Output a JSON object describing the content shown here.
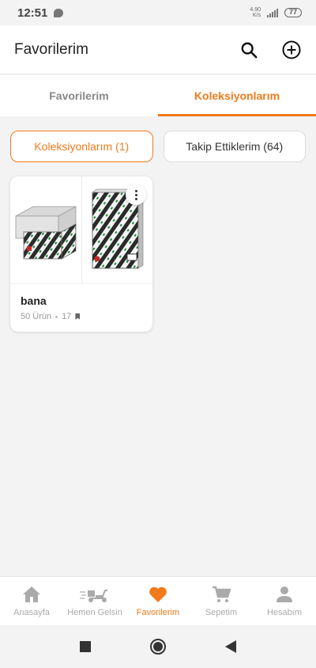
{
  "status_bar": {
    "time": "12:51",
    "net_speed_top": "4.90",
    "net_speed_bottom": "K/s",
    "battery": "77"
  },
  "header": {
    "title": "Favorilerim",
    "search_icon": "search-icon",
    "add_icon": "add-circle-icon"
  },
  "tabs": [
    {
      "label": "Favorilerim",
      "active": false
    },
    {
      "label": "Koleksiyonlarım",
      "active": true
    }
  ],
  "segments": [
    {
      "label": "Koleksiyonlarım (1)",
      "active": true
    },
    {
      "label": "Takip Ettiklerim (64)",
      "active": false
    }
  ],
  "collections": [
    {
      "name": "bana",
      "product_count": "50 Ürün",
      "follower_count": "17",
      "images": [
        "paper-box-image",
        "paper-ream-image"
      ]
    }
  ],
  "bottom_nav": [
    {
      "label": "Anasayfa",
      "icon": "home-icon",
      "active": false
    },
    {
      "label": "Hemen Gelsin",
      "icon": "scooter-icon",
      "active": false
    },
    {
      "label": "Favorilerim",
      "icon": "heart-icon",
      "active": true
    },
    {
      "label": "Sepetim",
      "icon": "cart-icon",
      "active": false
    },
    {
      "label": "Hesabım",
      "icon": "user-icon",
      "active": false
    }
  ],
  "colors": {
    "accent": "#f27a1a",
    "background": "#f3f3f3",
    "inactive": "#aaaaaa"
  }
}
